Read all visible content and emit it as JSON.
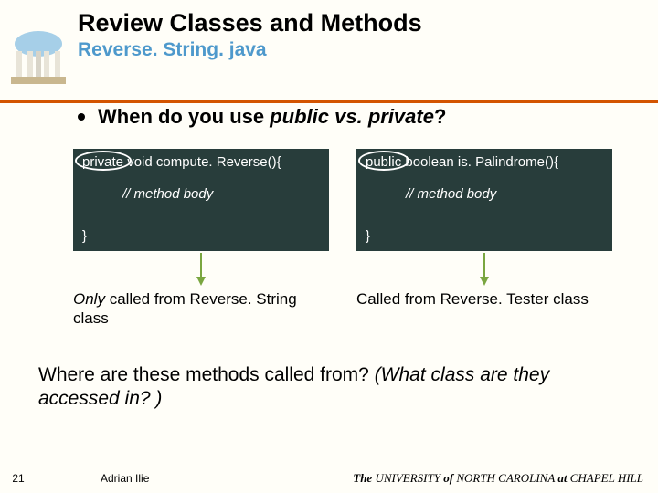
{
  "header": {
    "title": "Review Classes and Methods",
    "subtitle": "Reverse. String. java"
  },
  "bullet": {
    "prefix": "When do you use ",
    "italic": "public vs. private",
    "suffix": "?"
  },
  "left": {
    "sig": "private void compute. Reverse(){",
    "body": "// method body",
    "brace": "}",
    "caption_italic": "Only",
    "caption_rest": " called from Reverse. String class"
  },
  "right": {
    "sig": "public boolean is. Palindrome(){",
    "body": "// method body",
    "brace": "}",
    "caption": "Called from Reverse. Tester class"
  },
  "question": {
    "plain": "Where are these methods called from?  ",
    "italic": "(What class are they accessed in? )"
  },
  "footer": {
    "page": "21",
    "author": "Adrian Ilie",
    "uni_the": "The",
    "uni_mid1": " UNIVERSITY ",
    "uni_of": "of",
    "uni_mid2": " NORTH CAROLINA ",
    "uni_at": "at",
    "uni_end": " CHAPEL HILL"
  }
}
